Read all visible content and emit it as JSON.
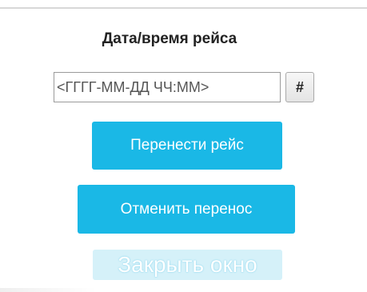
{
  "dialog": {
    "title": "Дата/время рейса",
    "datetime_input": {
      "value": "",
      "placeholder": "<ГГГГ-ММ-ДД ЧЧ:ММ>"
    },
    "picker_button_label": "#",
    "reschedule_button_label": "Перенести рейс",
    "cancel_reschedule_button_label": "Отменить перенос",
    "close_window_button_label": "Закрыть окно"
  },
  "colors": {
    "primary_button": "#1ab8e6",
    "disabled_button": "#d5f1f9",
    "divider": "#d7d7d7"
  }
}
